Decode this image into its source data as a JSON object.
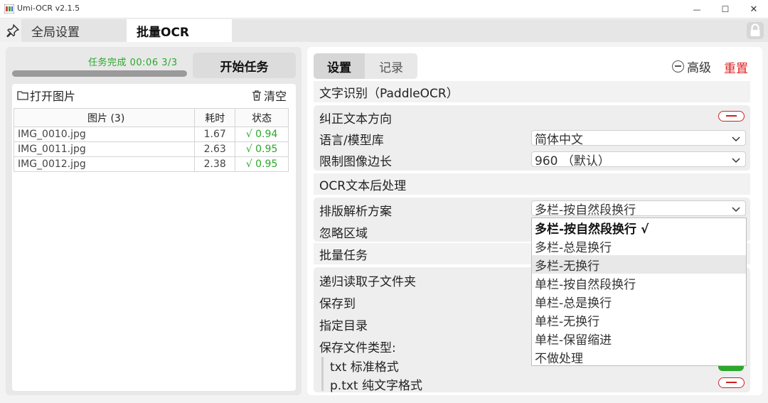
{
  "window": {
    "title": "Umi-OCR v2.1.5"
  },
  "window_controls": {
    "minimize": "—",
    "maximize": "☐",
    "close": "✕"
  },
  "tabs": {
    "global": "全局设置",
    "batch": "批量OCR"
  },
  "left": {
    "status": "任务完成   00:06   3/3",
    "progress": 1.0,
    "start_button": "开始任务",
    "open_button": "打开图片",
    "clear_button": "清空",
    "table": {
      "headers": [
        "图片 (3)",
        "耗时",
        "状态"
      ],
      "rows": [
        {
          "name": "IMG_0010.jpg",
          "time": "1.67",
          "status": "√ 0.94"
        },
        {
          "name": "IMG_0011.jpg",
          "time": "2.63",
          "status": "√ 0.95"
        },
        {
          "name": "IMG_0012.jpg",
          "time": "2.38",
          "status": "√ 0.95"
        }
      ]
    }
  },
  "right": {
    "tabs": {
      "settings": "设置",
      "records": "记录"
    },
    "advanced": "高级",
    "reset": "重置",
    "sections": {
      "ocr": "文字识别（PaddleOCR）",
      "post": "OCR文本后处理",
      "batch": "批量任务"
    },
    "ocr_rows": {
      "correct_direction": "纠正文本方向",
      "language": "语言/模型库",
      "language_value": "简体中文",
      "limit_side": "限制图像边长",
      "limit_side_value": "960 （默认）"
    },
    "post_rows": {
      "layout": "排版解析方案",
      "layout_value": "多栏-按自然段换行",
      "ignore_area": "忽略区域"
    },
    "layout_options": [
      "多栏-按自然段换行 √",
      "多栏-总是换行",
      "多栏-无换行",
      "单栏-按自然段换行",
      "单栏-总是换行",
      "单栏-无换行",
      "单栏-保留缩进",
      "不做处理"
    ],
    "batch_rows": {
      "recursive": "递归读取子文件夹",
      "save_to": "保存到",
      "target_dir": "指定目录",
      "file_types": "保存文件类型:",
      "txt": "txt 标准格式",
      "ptxt": "p.txt 纯文字格式"
    }
  },
  "colors": {
    "success": "#2aa82a",
    "danger": "#e02020"
  }
}
